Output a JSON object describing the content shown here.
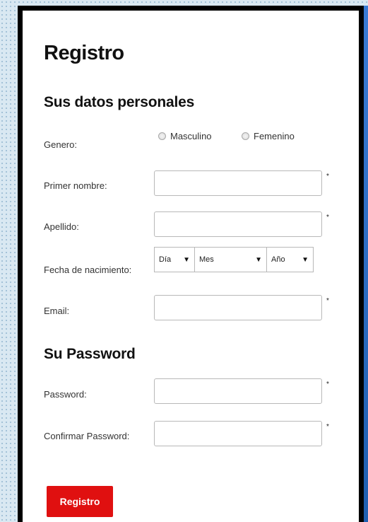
{
  "form": {
    "title": "Registro",
    "personal_section": "Sus datos personales",
    "gender": {
      "label": "Genero:",
      "options": [
        "Masculino",
        "Femenino"
      ]
    },
    "first_name": {
      "label": "Primer nombre:",
      "value": "",
      "required_mark": "*"
    },
    "last_name": {
      "label": "Apellido:",
      "value": "",
      "required_mark": "*"
    },
    "birthdate": {
      "label": "Fecha de nacimiento:",
      "day": "Día",
      "month": "Mes",
      "year": "Año"
    },
    "email": {
      "label": "Email:",
      "value": "",
      "required_mark": "*"
    },
    "password_section": "Su Password",
    "password": {
      "label": "Password:",
      "value": "",
      "required_mark": "*"
    },
    "confirm_password": {
      "label": "Confirmar Password:",
      "value": "",
      "required_mark": "*"
    },
    "submit_label": "Registro"
  },
  "colors": {
    "submit_bg": "#e01010",
    "frame": "#000000",
    "page_bg": "#d9e8f2"
  }
}
